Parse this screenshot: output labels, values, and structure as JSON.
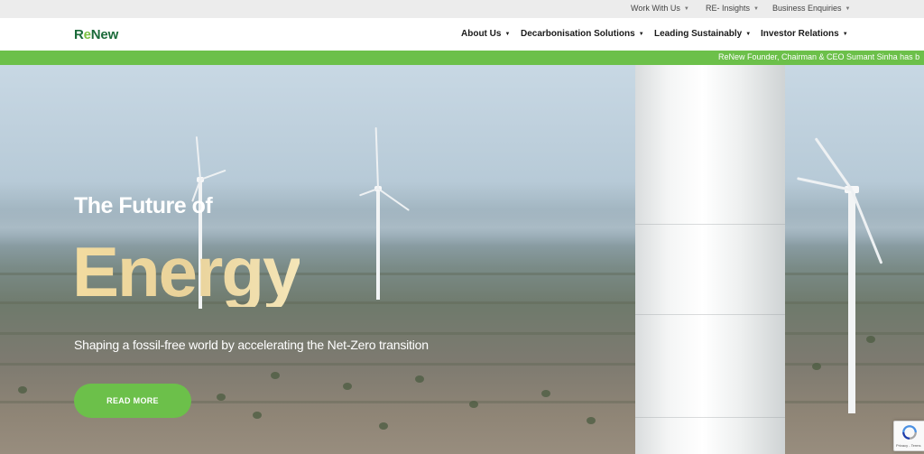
{
  "utility_nav": {
    "items": [
      {
        "label": "Work With Us"
      },
      {
        "label": "RE- Insights"
      },
      {
        "label": "Business Enquiries"
      }
    ]
  },
  "header": {
    "logo": {
      "part1": "R",
      "part2": "e",
      "part3": "New"
    },
    "nav": [
      {
        "label": "About Us"
      },
      {
        "label": "Decarbonisation Solutions"
      },
      {
        "label": "Leading Sustainably"
      },
      {
        "label": "Investor Relations"
      }
    ]
  },
  "ticker": {
    "text": "ReNew Founder, Chairman & CEO Sumant Sinha has b"
  },
  "hero": {
    "pretitle": "The Future of",
    "title": "Energy",
    "subtitle": "Shaping a fossil-free world by accelerating the Net-Zero transition",
    "cta_label": "READ MORE"
  },
  "recaptcha": {
    "text": "Privacy - Terms"
  },
  "colors": {
    "brand_green": "#6cc04a",
    "logo_dark_green": "#1b6b3a",
    "title_gold": "#e9d29a"
  }
}
